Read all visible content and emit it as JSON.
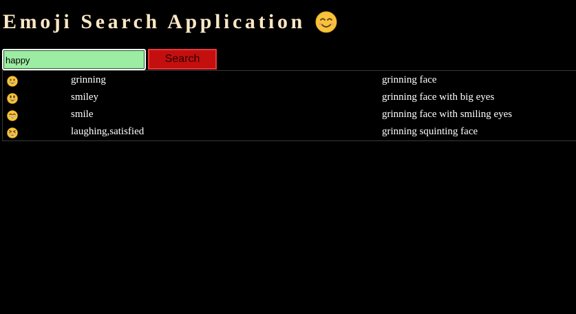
{
  "app": {
    "title": "Emoji Search Application",
    "title_icon": "smiling-face-with-smiling-eyes-icon"
  },
  "search": {
    "value": "happy",
    "button_label": "Search"
  },
  "results": [
    {
      "icon": "grinning-face-icon",
      "codes": "grinning",
      "name": "grinning face"
    },
    {
      "icon": "grinning-face-with-big-eyes-icon",
      "codes": "smiley",
      "name": "grinning face with big eyes"
    },
    {
      "icon": "grinning-face-with-smiling-eyes-icon",
      "codes": "smile",
      "name": "grinning face with smiling eyes"
    },
    {
      "icon": "grinning-squinting-face-icon",
      "codes": "laughing,satisfied",
      "name": "grinning squinting face"
    }
  ],
  "colors": {
    "background": "#000000",
    "title": "#fbe7c6",
    "input_bg": "#9ceca3",
    "button_bg": "#c40f0f",
    "emoji_yellow": "#f7c33b"
  }
}
